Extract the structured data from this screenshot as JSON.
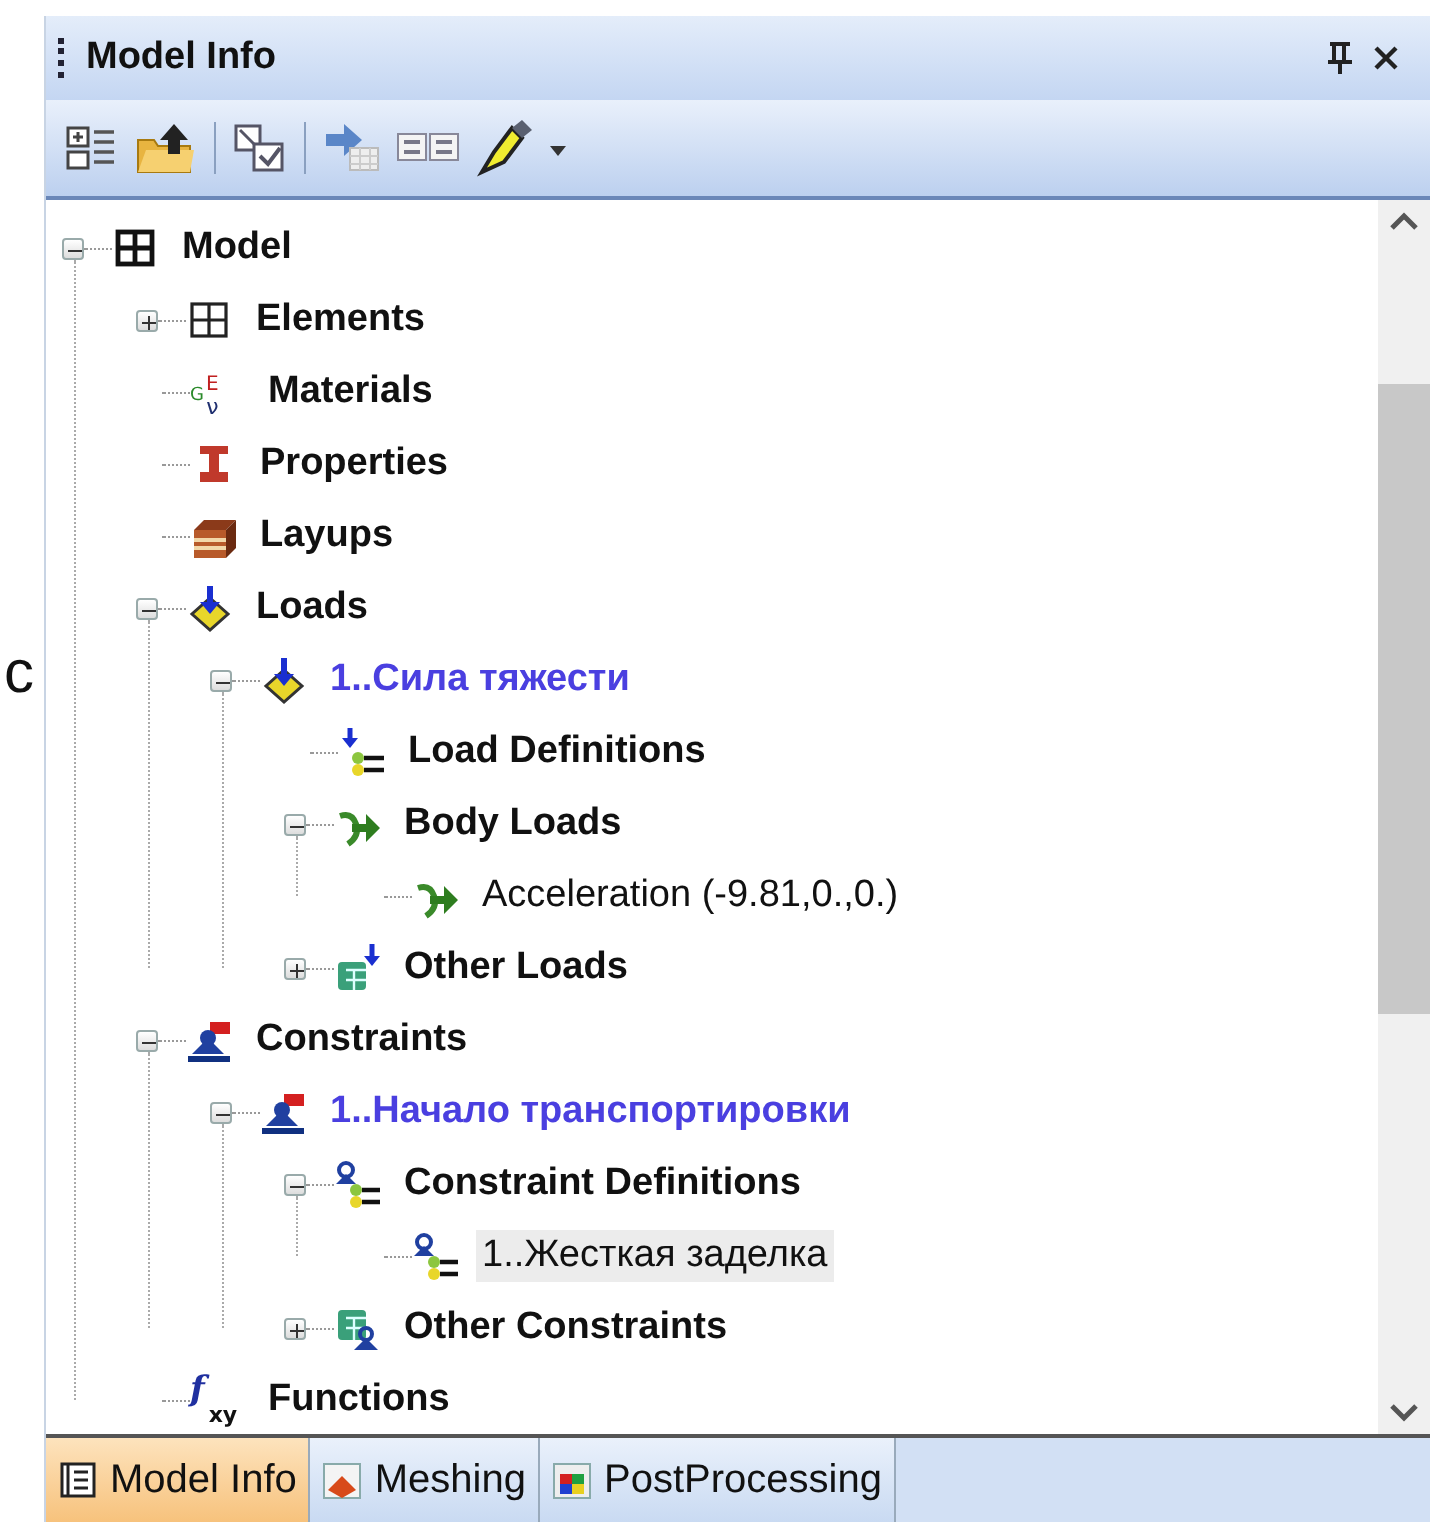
{
  "side_text": "c",
  "panel": {
    "title": "Model Info"
  },
  "tree": [
    {
      "label": "Model",
      "kind": "model",
      "expanded": true,
      "selected": false,
      "children": [
        {
          "label": "Elements",
          "kind": "elements",
          "expanded": false,
          "selected": false
        },
        {
          "label": "Materials",
          "kind": "materials",
          "icon_letters": [
            "G",
            "E",
            "ν"
          ],
          "selected": false
        },
        {
          "label": "Properties",
          "kind": "properties",
          "selected": false
        },
        {
          "label": "Layups",
          "kind": "layups",
          "selected": false
        },
        {
          "label": "Loads",
          "kind": "loads",
          "expanded": true,
          "selected": false,
          "children": [
            {
              "label": "1..Сила тяжести",
              "kind": "load-set",
              "expanded": true,
              "selected": false,
              "children": [
                {
                  "label": "Load Definitions",
                  "kind": "load-definitions",
                  "selected": false
                },
                {
                  "label": "Body Loads",
                  "kind": "body-loads",
                  "expanded": true,
                  "selected": false,
                  "children": [
                    {
                      "label": "Acceleration (-9.81,0.,0.)",
                      "kind": "acceleration",
                      "selected": false
                    }
                  ]
                },
                {
                  "label": "Other Loads",
                  "kind": "other-loads",
                  "expanded": false,
                  "selected": false
                }
              ]
            }
          ]
        },
        {
          "label": "Constraints",
          "kind": "constraints",
          "expanded": true,
          "selected": false,
          "children": [
            {
              "label": "1..Начало транспортировки",
              "kind": "constraint-set",
              "expanded": true,
              "selected": false,
              "children": [
                {
                  "label": "Constraint Definitions",
                  "kind": "constraint-definitions",
                  "expanded": true,
                  "selected": false,
                  "children": [
                    {
                      "label": "1..Жесткая заделка",
                      "kind": "constraint",
                      "selected": true
                    }
                  ]
                },
                {
                  "label": "Other Constraints",
                  "kind": "other-constraints",
                  "expanded": false,
                  "selected": false
                }
              ]
            }
          ]
        },
        {
          "label": "Functions",
          "kind": "functions",
          "icon_letters": [
            "f",
            "xy"
          ],
          "selected": false
        }
      ]
    }
  ],
  "tabs": [
    {
      "label": "Model Info",
      "kind": "model-info",
      "selected": true
    },
    {
      "label": "Meshing",
      "kind": "meshing",
      "selected": false
    },
    {
      "label": "PostProcessing",
      "kind": "post",
      "selected": false
    }
  ]
}
